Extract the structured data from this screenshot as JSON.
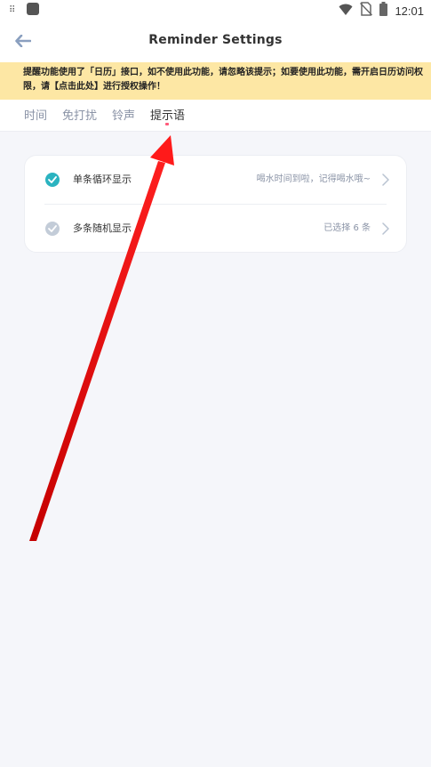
{
  "status_bar": {
    "time": "12:01",
    "left_icon": "notification-icon",
    "app_icon": "app-square-icon"
  },
  "header": {
    "title": "Reminder Settings",
    "back_icon": "back-arrow-icon"
  },
  "notice": {
    "text": "提醒功能使用了「日历」接口，如不使用此功能，请忽略该提示；如要使用此功能，需开启日历访问权限，请【点击此处】进行授权操作！",
    "background": "#fde7a4"
  },
  "tabs": [
    {
      "label": "时间"
    },
    {
      "label": "免打扰"
    },
    {
      "label": "铃声"
    },
    {
      "label": "提示语"
    }
  ],
  "active_tab": "提示语",
  "colors": {
    "accent": "#2bb3c0",
    "indicator": "#ff5b7a",
    "muted": "#b9c3d1"
  },
  "options": [
    {
      "label": "单条循环显示",
      "value": "喝水时间到啦，记得喝水哦~",
      "checked": true
    },
    {
      "label": "多条随机显示",
      "value": "已选择 6 条",
      "checked": false
    }
  ]
}
